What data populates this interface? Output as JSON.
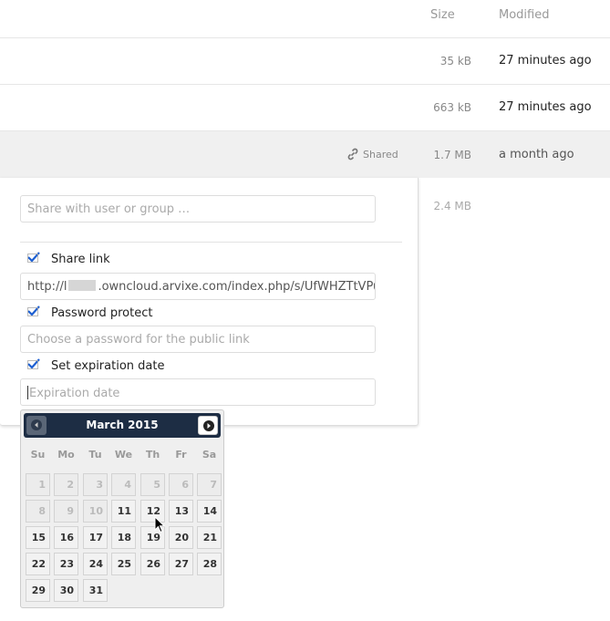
{
  "header": {
    "size_label": "Size",
    "modified_label": "Modified"
  },
  "files": [
    {
      "size": "35 kB",
      "modified": "27 minutes ago"
    },
    {
      "size": "663 kB",
      "modified": "27 minutes ago"
    },
    {
      "size": "1.7 MB",
      "modified": "a month ago",
      "shared_label": "Shared"
    },
    {
      "size": "2.4 MB"
    }
  ],
  "share": {
    "user_placeholder": "Share with user or group …",
    "share_link_label": "Share link",
    "link_prefix": "http://l",
    "link_suffix": ".owncloud.arvixe.com/index.php/s/UfWHZTtVPuZJ",
    "password_label": "Password protect",
    "password_placeholder": "Choose a password for the public link",
    "expiration_label": "Set expiration date",
    "expiration_placeholder": "Expiration date"
  },
  "datepicker": {
    "title": "March 2015",
    "weekdays": [
      "Su",
      "Mo",
      "Tu",
      "We",
      "Th",
      "Fr",
      "Sa"
    ],
    "weeks": [
      [
        "1",
        "2",
        "3",
        "4",
        "5",
        "6",
        "7"
      ],
      [
        "8",
        "9",
        "10",
        "11",
        "12",
        "13",
        "14"
      ],
      [
        "15",
        "16",
        "17",
        "18",
        "19",
        "20",
        "21"
      ],
      [
        "22",
        "23",
        "24",
        "25",
        "26",
        "27",
        "28"
      ],
      [
        "29",
        "30",
        "31"
      ]
    ]
  },
  "colors": {
    "accent": "#1d2d44",
    "check": "#1d5fd1"
  }
}
